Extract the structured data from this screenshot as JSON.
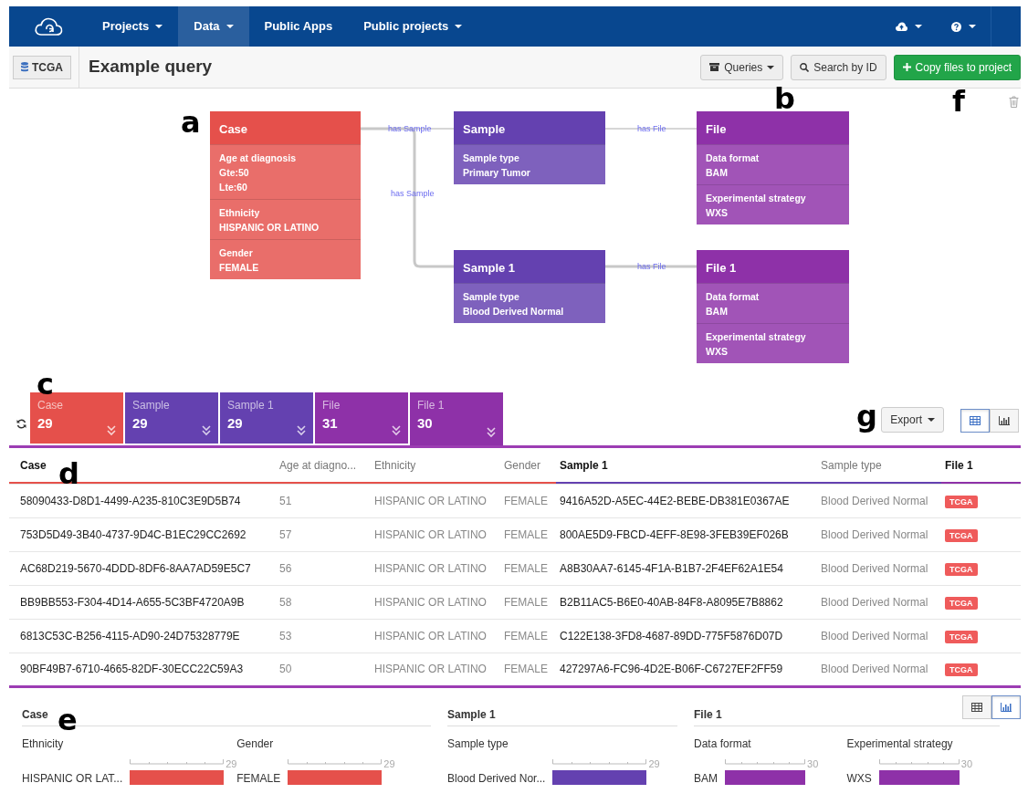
{
  "navbar": {
    "items": [
      {
        "label": "Projects",
        "dropdown": true,
        "selected": false
      },
      {
        "label": "Data",
        "dropdown": true,
        "selected": true
      },
      {
        "label": "Public Apps",
        "dropdown": false,
        "selected": false
      },
      {
        "label": "Public projects",
        "dropdown": true,
        "selected": false
      }
    ]
  },
  "header": {
    "dataset_button": "TCGA",
    "title": "Example query",
    "buttons": [
      {
        "label": "Queries",
        "kind": "menu"
      },
      {
        "label": "Search by ID",
        "kind": "search"
      },
      {
        "label": "Copy files to project",
        "kind": "primary"
      }
    ]
  },
  "panel_labels": [
    "b",
    "f",
    "a",
    "c",
    "g",
    "d",
    "e"
  ],
  "diagram": {
    "nodes": [
      {
        "title": "Case",
        "color": "#e5504b",
        "filters": [
          {
            "label": "Age at diagnosis",
            "values": [
              "Gte:50",
              "Lte:60"
            ]
          },
          {
            "label": "Ethnicity",
            "values": [
              "HISPANIC OR LATINO"
            ]
          },
          {
            "label": "Gender",
            "values": [
              "FEMALE"
            ]
          }
        ]
      },
      {
        "title": "Sample",
        "color": "#6441b0",
        "filters": [
          {
            "label": "Sample type",
            "values": [
              "Primary Tumor"
            ]
          }
        ]
      },
      {
        "title": "File",
        "color": "#8e31a8",
        "filters": [
          {
            "label": "Data format",
            "values": [
              "BAM"
            ]
          },
          {
            "label": "Experimental strategy",
            "values": [
              "WXS"
            ]
          }
        ]
      },
      {
        "title": "Sample 1",
        "color": "#6441b0",
        "filters": [
          {
            "label": "Sample type",
            "values": [
              "Blood Derived Normal"
            ]
          }
        ]
      },
      {
        "title": "File 1",
        "color": "#8e31a8",
        "filters": [
          {
            "label": "Data format",
            "values": [
              "BAM"
            ]
          },
          {
            "label": "Experimental strategy",
            "values": [
              "WXS"
            ]
          }
        ]
      }
    ],
    "edges": [
      {
        "label": "has Sample"
      },
      {
        "label": "has Sample"
      },
      {
        "label": "has File"
      },
      {
        "label": "has File"
      }
    ]
  },
  "tiles": [
    {
      "label": "Case",
      "count": "29",
      "color": "#e5504b",
      "selected": false
    },
    {
      "label": "Sample",
      "count": "29",
      "color": "#6441b0",
      "selected": false
    },
    {
      "label": "Sample 1",
      "count": "29",
      "color": "#6441b0",
      "selected": false
    },
    {
      "label": "File",
      "count": "31",
      "color": "#8e31a8",
      "selected": false
    },
    {
      "label": "File 1",
      "count": "30",
      "color": "#8e31a8",
      "selected": true
    }
  ],
  "export_button": "Export",
  "table_view_toggles": [
    {
      "kind": "table",
      "selected": true
    },
    {
      "kind": "chart",
      "selected": false
    }
  ],
  "table": {
    "columns": [
      {
        "label": "Case",
        "kind": "id",
        "color": "#e5504b"
      },
      {
        "label": "Age at diagno...",
        "kind": "attribute",
        "color": "#e5504b"
      },
      {
        "label": "Ethnicity",
        "kind": "attribute",
        "color": "#e5504b"
      },
      {
        "label": "Gender",
        "kind": "attribute",
        "color": "#e5504b"
      },
      {
        "label": "Sample 1",
        "kind": "id",
        "color": "#6441b0"
      },
      {
        "label": "Sample type",
        "kind": "attribute",
        "color": "#6441b0"
      },
      {
        "label": "File 1",
        "kind": "tag",
        "color": "#8e31a8"
      }
    ],
    "rows": [
      [
        "58090433-D8D1-4499-A235-810C3E9D5B74",
        "51",
        "HISPANIC OR LATINO",
        "FEMALE",
        "9416A52D-A5EC-44E2-BEBE-DB381E0367AE",
        "Blood Derived Normal",
        "TCGA"
      ],
      [
        "753D5D49-3B40-4737-9D4C-B1EC29CC2692",
        "57",
        "HISPANIC OR LATINO",
        "FEMALE",
        "800AE5D9-FBCD-4EFF-8E98-3FEB39EF026B",
        "Blood Derived Normal",
        "TCGA"
      ],
      [
        "AC68D219-5670-4DDD-8DF6-8AA7AD59E5C7",
        "56",
        "HISPANIC OR LATINO",
        "FEMALE",
        "A8B30AA7-6145-4F1A-B1B7-2F4EF62A1E54",
        "Blood Derived Normal",
        "TCGA"
      ],
      [
        "BB9BB553-F304-4D14-A655-5C3BF4720A9B",
        "58",
        "HISPANIC OR LATINO",
        "FEMALE",
        "B2B11AC5-B6E0-40AB-84F8-A8095E7B8862",
        "Blood Derived Normal",
        "TCGA"
      ],
      [
        "6813C53C-B256-4115-AD90-24D75328779E",
        "53",
        "HISPANIC OR LATINO",
        "FEMALE",
        "C122E138-3FD8-4687-89DD-775F5876D07D",
        "Blood Derived Normal",
        "TCGA"
      ],
      [
        "90BF49B7-6710-4665-82DF-30ECC22C59A3",
        "50",
        "HISPANIC OR LATINO",
        "FEMALE",
        "427297A6-FC96-4D2E-B06F-C6727EF2FF59",
        "Blood Derived Normal",
        "TCGA"
      ]
    ]
  },
  "summary": {
    "view_toggles": [
      {
        "kind": "table",
        "selected": false
      },
      {
        "kind": "chart",
        "selected": true
      }
    ],
    "groups": [
      {
        "title": "Case",
        "charts": [
          {
            "label": "Ethnicity",
            "category": "HISPANIC OR LAT...",
            "max": "29",
            "color": "#e5504b"
          },
          {
            "label": "Gender",
            "category": "FEMALE",
            "max": "29",
            "color": "#e5504b"
          }
        ]
      },
      {
        "title": "Sample 1",
        "charts": [
          {
            "label": "Sample type",
            "category": "Blood Derived Nor...",
            "max": "29",
            "color": "#6441b0"
          }
        ]
      },
      {
        "title": "File 1",
        "charts": [
          {
            "label": "Data format",
            "category": "BAM",
            "max": "30",
            "color": "#8e31a8"
          },
          {
            "label": "Experimental strategy",
            "category": "WXS",
            "max": "30",
            "color": "#8e31a8"
          }
        ]
      }
    ]
  }
}
